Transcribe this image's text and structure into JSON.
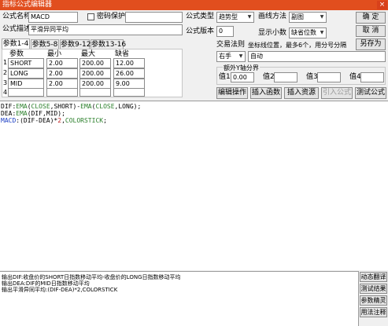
{
  "window": {
    "title": "指标公式编辑器",
    "close_label": "×"
  },
  "form": {
    "name_label": "公式名称",
    "name_value": "MACD",
    "password_label": "密码保护",
    "password_value": "",
    "desc_label": "公式描述",
    "desc_value": "平滑异同平均",
    "type_label": "公式类型",
    "type_value": "趋势型",
    "draw_label": "画线方法",
    "draw_value": "副图",
    "version_label": "公式版本",
    "version_value": "0",
    "decimals_label": "显示小数",
    "decimals_value": "缺省位数"
  },
  "buttons": {
    "ok": "确  定",
    "cancel": "取  消",
    "save_as": "另存为",
    "edit_ops": "编辑操作",
    "insert_func": "插入函数",
    "insert_res": "插入资源",
    "import_formula": "引入公式",
    "test_formula": "测试公式"
  },
  "tabs": [
    "参数1-4",
    "参数5-8",
    "参数9-12",
    "参数13-16"
  ],
  "param_table": {
    "headers": [
      "参数",
      "最小",
      "最大",
      "缺省"
    ],
    "rows": [
      {
        "num": "1",
        "name": "SHORT",
        "min": "2.00",
        "max": "200.00",
        "default": "12.00"
      },
      {
        "num": "2",
        "name": "LONG",
        "min": "2.00",
        "max": "200.00",
        "default": "26.00"
      },
      {
        "num": "3",
        "name": "MID",
        "min": "2.00",
        "max": "200.00",
        "default": "9.00"
      },
      {
        "num": "4",
        "name": "",
        "min": "",
        "max": "",
        "default": ""
      }
    ]
  },
  "trade_rule": {
    "label": "交易法则",
    "coord_hint": "坐标线位置，最多6个，用分号分隔",
    "rule_value": "右手",
    "coord_value": "自动"
  },
  "axis_bounds": {
    "title": "额外Y轴分界",
    "v1_label": "值1",
    "v1_value": "0.00",
    "v2_label": "值2",
    "v2_value": "",
    "v3_label": "值3",
    "v3_value": "",
    "v4_label": "值4",
    "v4_value": ""
  },
  "code": [
    [
      {
        "t": "DIF:",
        "c": "#000000"
      },
      {
        "t": "EMA",
        "c": "#2a7f2a"
      },
      {
        "t": "(",
        "c": "#000000"
      },
      {
        "t": "CLOSE",
        "c": "#2a7f2a"
      },
      {
        "t": ",SHORT)-",
        "c": "#000000"
      },
      {
        "t": "EMA",
        "c": "#2a7f2a"
      },
      {
        "t": "(",
        "c": "#000000"
      },
      {
        "t": "CLOSE",
        "c": "#2a7f2a"
      },
      {
        "t": ",LONG);",
        "c": "#000000"
      }
    ],
    [
      {
        "t": "DEA:",
        "c": "#000000"
      },
      {
        "t": "EMA",
        "c": "#2a7f2a"
      },
      {
        "t": "(DIF,MID);",
        "c": "#000000"
      }
    ],
    [
      {
        "t": "MACD",
        "c": "#1c3fc4"
      },
      {
        "t": ":(DIF-DEA)*",
        "c": "#000000"
      },
      {
        "t": "2",
        "c": "#c02020"
      },
      {
        "t": ",",
        "c": "#000000"
      },
      {
        "t": "COLORSTICK",
        "c": "#2a7f2a"
      },
      {
        "t": ";",
        "c": "#000000"
      }
    ]
  ],
  "output_lines": [
    "输出DIF:收盘价的SHORT日指数移动平均-收盘价的LONG日指数移动平均",
    "输出DEA:DIF的MID日指数移动平均",
    "输出平滑异同平均:(DIF-DEA)*2,COLORSTICK"
  ],
  "side_buttons": [
    "动态翻译",
    "测试结果",
    "参数精灵",
    "用法注释"
  ]
}
